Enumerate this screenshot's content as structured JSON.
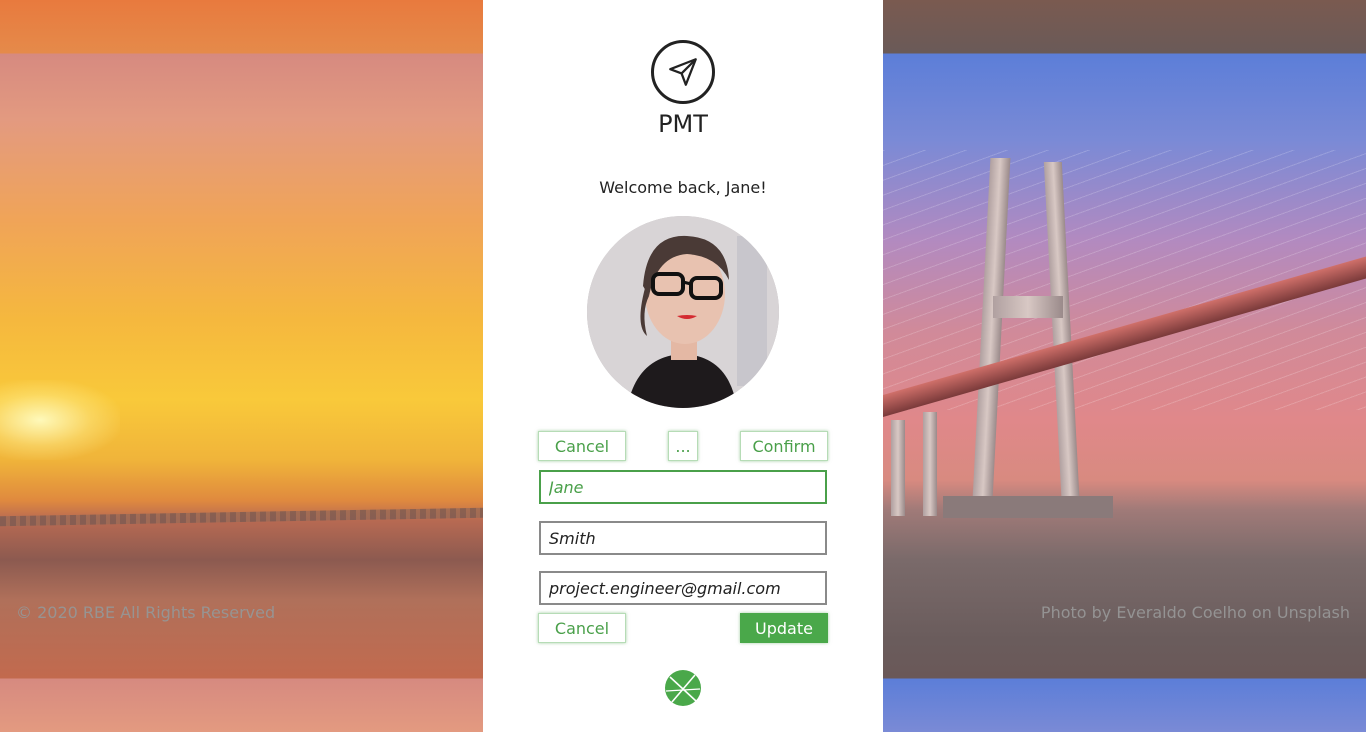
{
  "app": {
    "title": "PMT",
    "logo_icon": "paper-plane-icon",
    "footer_logo_icon": "circle-x-logo-icon"
  },
  "welcome_text": "Welcome back, Jane!",
  "avatar_icon": "user-photo",
  "top_actions": {
    "cancel_label": "Cancel",
    "more_label": "...",
    "confirm_label": "Confirm"
  },
  "form": {
    "first_name": "Jane",
    "last_name": "Smith",
    "email": "project.engineer@gmail.com"
  },
  "bottom_actions": {
    "cancel_label": "Cancel",
    "update_label": "Update"
  },
  "footer": {
    "copyright": "© 2020 RBE All Rights Reserved",
    "photo_credit": "Photo by Everaldo Coelho on Unsplash"
  },
  "colors": {
    "accent": "#4aa84a",
    "text": "#222222"
  }
}
